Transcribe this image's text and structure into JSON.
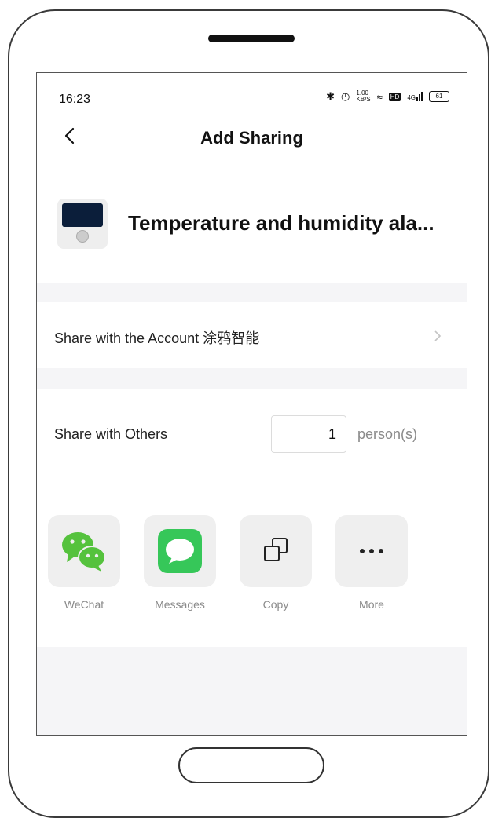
{
  "status_bar": {
    "time": "16:23",
    "speed": "1.00",
    "speed_unit": "KB/S",
    "network": "4G",
    "battery": "61"
  },
  "header": {
    "title": "Add Sharing"
  },
  "device": {
    "name": "Temperature and humidity ala..."
  },
  "account_row": {
    "label": "Share with the Account 涂鸦智能"
  },
  "others_row": {
    "label": "Share with Others",
    "count": "1",
    "unit": "person(s)"
  },
  "share_targets": [
    {
      "label": "WeChat",
      "icon": "wechat-icon"
    },
    {
      "label": "Messages",
      "icon": "messages-icon"
    },
    {
      "label": "Copy",
      "icon": "copy-icon"
    },
    {
      "label": "More",
      "icon": "more-icon"
    }
  ],
  "colors": {
    "wechat_green": "#55c23d",
    "messages_green": "#36c759",
    "page_bg": "#f5f5f7"
  }
}
